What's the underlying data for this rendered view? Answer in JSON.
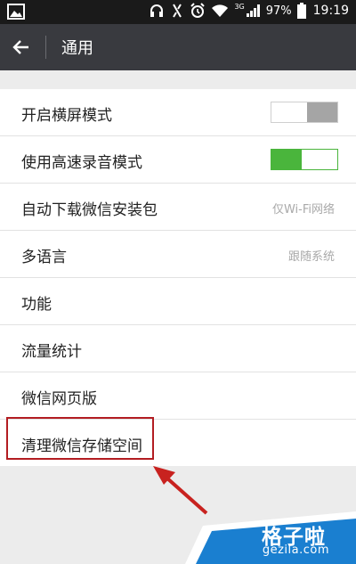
{
  "status_bar": {
    "network": "3G",
    "battery_percent": "97%",
    "time": "19:19"
  },
  "toolbar": {
    "title": "通用"
  },
  "settings": {
    "landscape_mode": {
      "label": "开启横屏模式",
      "enabled": false
    },
    "hq_recording": {
      "label": "使用高速录音模式",
      "enabled": true
    },
    "auto_download": {
      "label": "自动下载微信安装包",
      "value": "仅Wi-Fi网络"
    },
    "language": {
      "label": "多语言",
      "value": "跟随系统"
    },
    "features": {
      "label": "功能"
    },
    "data_usage": {
      "label": "流量统计"
    },
    "web_version": {
      "label": "微信网页版"
    },
    "clear_storage": {
      "label": "清理微信存储空间"
    }
  },
  "watermark": {
    "brand": "格子啦",
    "site": "gezila.com"
  },
  "colors": {
    "toolbar_bg": "#393a3f",
    "toggle_on": "#4ab53c",
    "highlight_border": "#b31d22",
    "watermark_blue": "#1a7fd0"
  }
}
